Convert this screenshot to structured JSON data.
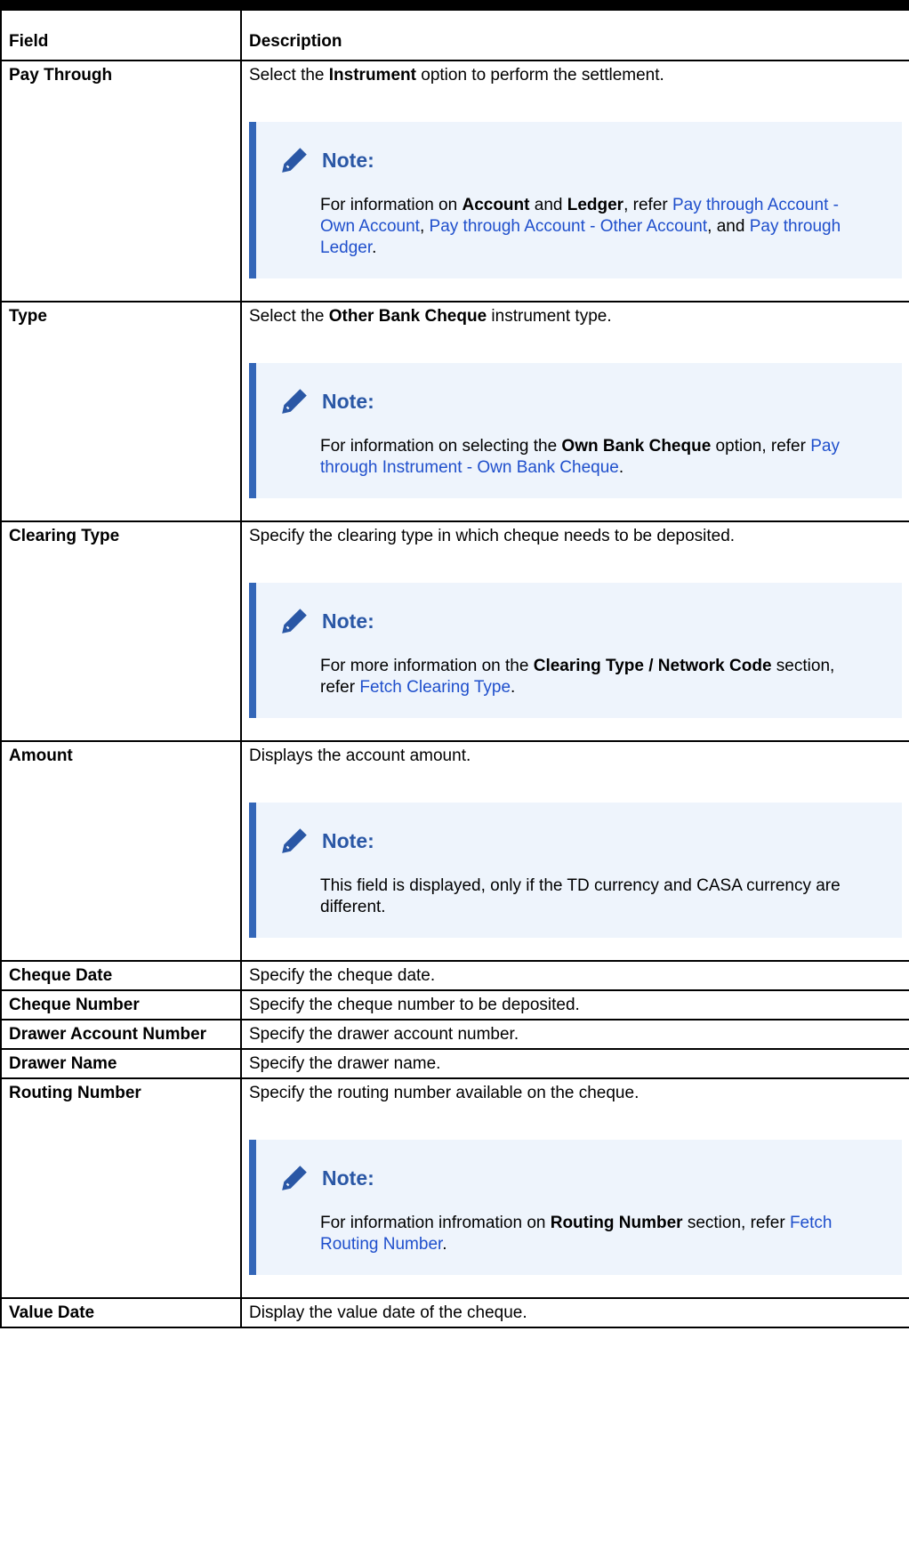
{
  "header": {
    "field": "Field",
    "description": "Description"
  },
  "rows": {
    "pay_through": {
      "field": "Pay Through",
      "desc": {
        "a": "Select the ",
        "b": "Instrument",
        "c": " option to perform the settlement."
      },
      "note": {
        "title": "Note:",
        "t1": "For information on ",
        "b1": "Account",
        "t2": " and ",
        "b2": "Ledger",
        "t3": ", refer ",
        "l1": "Pay through Account - Own Account",
        "t4": ", ",
        "l2": "Pay through Account - Other Account",
        "t5": ", and ",
        "l3": "Pay through Ledger",
        "t6": "."
      }
    },
    "type": {
      "field": "Type",
      "desc": {
        "a": "Select the ",
        "b": "Other Bank Cheque",
        "c": " instrument type."
      },
      "note": {
        "title": "Note:",
        "t1": "For information on selecting the ",
        "b1": "Own Bank Cheque",
        "t2": " option, refer ",
        "l1": "Pay through Instrument - Own Bank Cheque",
        "t3": "."
      }
    },
    "clearing_type": {
      "field": "Clearing Type",
      "desc": "Specify the clearing type in which cheque needs to be deposited.",
      "note": {
        "title": "Note:",
        "t1": "For more information on the ",
        "b1": "Clearing Type / Network Code",
        "t2": " section, refer ",
        "l1": "Fetch Clearing Type",
        "t3": "."
      }
    },
    "amount": {
      "field": "Amount",
      "desc": "Displays the account amount.",
      "note": {
        "title": "Note:",
        "t1": "This field is displayed, only if the TD currency and CASA currency are different."
      }
    },
    "cheque_date": {
      "field": "Cheque Date",
      "desc": "Specify the cheque date."
    },
    "cheque_number": {
      "field": "Cheque Number",
      "desc": "Specify the cheque number to be deposited."
    },
    "drawer_account_number": {
      "field": "Drawer Account Number",
      "desc": "Specify the drawer account number."
    },
    "drawer_name": {
      "field": "Drawer Name",
      "desc": "Specify the drawer name."
    },
    "routing_number": {
      "field": "Routing Number",
      "desc": "Specify the routing number available on the cheque.",
      "note": {
        "title": "Note:",
        "t1": "For information infromation on ",
        "b1": "Routing Number",
        "t2": " section, refer ",
        "l1": "Fetch Routing Number",
        "t3": "."
      }
    },
    "value_date": {
      "field": "Value Date",
      "desc": "Display the value date of the cheque."
    }
  },
  "icons": {
    "note": "pencil-icon"
  },
  "colors": {
    "note_bg": "#eef4fc",
    "note_bar": "#3366b8",
    "note_title": "#2a57a5",
    "link": "#1f4fcc"
  }
}
